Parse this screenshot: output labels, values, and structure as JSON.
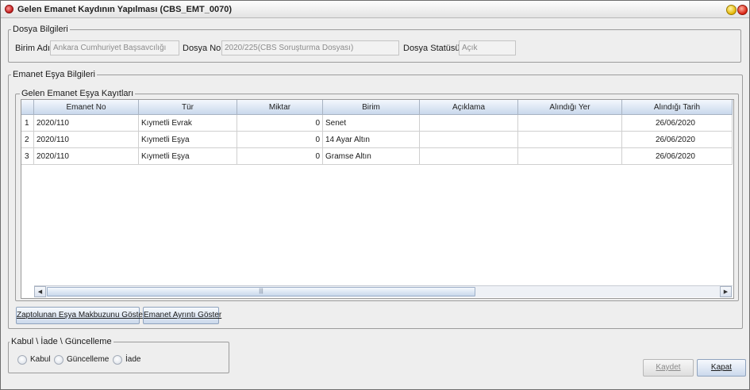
{
  "window": {
    "title": "Gelen Emanet Kaydının Yapılması (CBS_EMT_0070)"
  },
  "dosya": {
    "legend": "Dosya Bilgileri",
    "birim_label": "Birim Adı :",
    "birim_value": "Ankara Cumhuriyet Başsavcılığı",
    "dosya_no_label": "Dosya No :",
    "dosya_no_value": "2020/225(CBS Soruşturma Dosyası)",
    "statu_label": "Dosya Statüsü :",
    "statu_value": "Açık"
  },
  "emanet": {
    "legend": "Emanet Eşya Bilgileri",
    "table_legend": "Gelen Emanet Eşya Kayıtları",
    "columns": [
      "Emanet No",
      "Tür",
      "Miktar",
      "Birim",
      "Açıklama",
      "Alındığı Yer",
      "Alındığı Tarih"
    ],
    "rows": [
      {
        "num": "1",
        "emanet_no": "2020/110",
        "tur": "Kıymetli Evrak",
        "miktar": "0",
        "birim": "Senet",
        "aciklama": "",
        "alindigi_yer": "",
        "tarih": "26/06/2020"
      },
      {
        "num": "2",
        "emanet_no": "2020/110",
        "tur": "Kıymetli Eşya",
        "miktar": "0",
        "birim": "14 Ayar Altın",
        "aciklama": "",
        "alindigi_yer": "",
        "tarih": "26/06/2020"
      },
      {
        "num": "3",
        "emanet_no": "2020/110",
        "tur": "Kıymetli Eşya",
        "miktar": "0",
        "birim": "Gramse Altın",
        "aciklama": "",
        "alindigi_yer": "",
        "tarih": "26/06/2020"
      }
    ],
    "scroll_grip": "|||",
    "scroll_left": "◀",
    "scroll_right": "▶"
  },
  "buttons": {
    "makbuz": "Zaptolunan Eşya Makbuzunu Göster",
    "ayrinti": "Emanet Ayrıntı Göster",
    "kaydet": "Kaydet",
    "kapat": "Kapat"
  },
  "islem": {
    "legend": "Kabul \\ İade \\ Güncelleme",
    "options": [
      "Kabul",
      "Güncelleme",
      "İade"
    ]
  },
  "colors": {
    "header_gradient_top": "#f4f8fd",
    "header_gradient_bottom": "#c9d8ec",
    "window_bg": "#eeeeee"
  }
}
